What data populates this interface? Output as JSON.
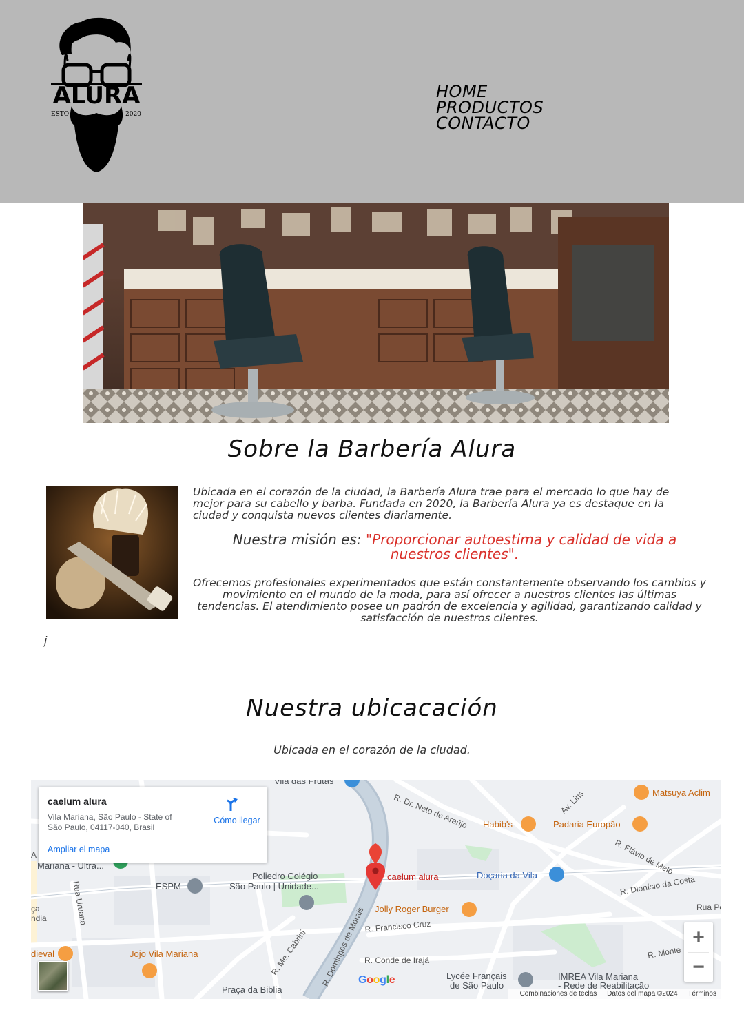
{
  "header": {
    "logo": {
      "text": "ALURA",
      "est": "ESTO",
      "year": "2020"
    },
    "nav": [
      "HOME",
      "PRODUCTOS",
      "CONTACTO"
    ]
  },
  "about": {
    "title": "Sobre la Barbería Alura",
    "intro": "Ubicada en el corazón de la ciudad, la Barbería Alura trae para el mercado lo que hay de mejor para su cabello y barba. Fundada en 2020, la Barbería Alura ya es destaque en la ciudad y conquista nuevos clientes diariamente.",
    "mission_label": "Nuestra misión es: ",
    "mission_quote": "\"Proporcionar autoestima y calidad de vida a nuestros clientes\".",
    "services": "Ofrecemos profesionales experimentados que están constantemente observando los cambios y movimiento en el mundo de la moda, para así ofrecer a nuestros clientes las últimas tendencias. El atendimiento posee un padrón de excelencia y agilidad, garantizando calidad y satisfacción de nuestros clientes.",
    "stray_char": "j"
  },
  "location": {
    "title": "Nuestra ubicacación",
    "subtitle": "Ubicada en el corazón de la ciudad."
  },
  "map": {
    "card": {
      "name": "caelum alura",
      "address": "Vila Mariana, São Paulo - State of São Paulo, 04117-040, Brasil",
      "directions": "Cómo llegar",
      "enlarge": "Ampliar el mapa"
    },
    "zoom_in": "+",
    "zoom_out": "−",
    "google": "Google",
    "attribution": [
      "Combinaciones de teclas",
      "Datos del mapa ©2024",
      "Términos"
    ],
    "labels": {
      "vila_das_frutas": "Vila das Frutas",
      "neto_araujo": "R. Dr. Neto de Araújo",
      "av_lins": "Av. Lins",
      "matsuya": "Matsuya Aclim",
      "habibs": "Habib's",
      "padaria": "Padaria Europão",
      "flavio": "R. Flávio de Melo",
      "dionisio": "R. Dionísio da Costa",
      "rua_po": "Rua Po",
      "mariana_ultra": "Mariana - Ultra...",
      "espm": "ESPM",
      "poliedro1": "Poliedro Colégio",
      "poliedro2": "São Paulo | Unidade...",
      "caelum": "caelum alura",
      "docaria": "Doçaria da Vila",
      "rua_uruana": "Rua Uruana",
      "jolly": "Jolly Roger Burger",
      "francisco": "R. Francisco Cruz",
      "domingos": "R. Domingos de Morais",
      "cabrini": "R. Me. Cabrini",
      "conde": "R. Conde de Irajá",
      "dieval": "dieval",
      "jojo": "Jojo Vila Mariana",
      "lycee1": "Lycée Français",
      "lycee2": "de São Paulo",
      "imrea1": "IMREA Vila Mariana",
      "imrea2": "- Rede de Reabilitação",
      "praca": "Praça da Biblia",
      "r_monte": "R. Monte",
      "aca": "ça",
      "ndia": "ndia",
      "a_left": "A"
    }
  }
}
